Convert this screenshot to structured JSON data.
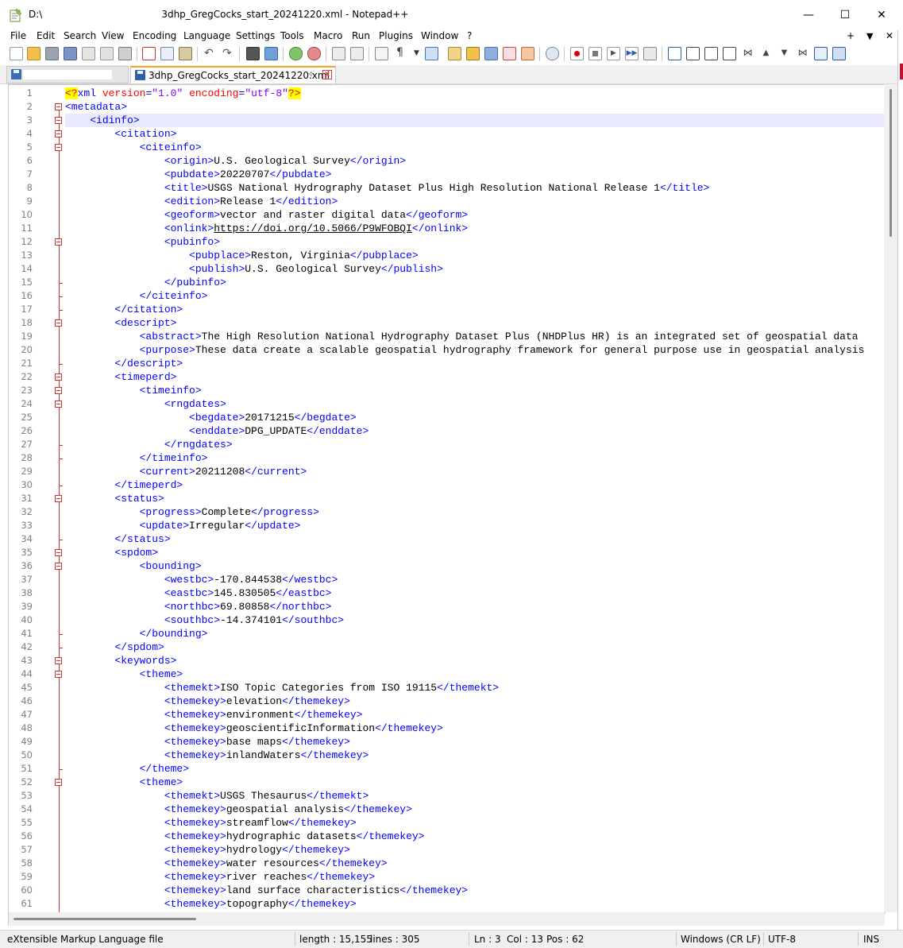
{
  "window": {
    "title_prefix": "D:\\",
    "title_suffix": "3dhp_GregCocks_start_20241220.xml - Notepad++",
    "minimize": "—",
    "maximize": "☐",
    "close": "✕"
  },
  "menu": [
    "File",
    "Edit",
    "Search",
    "View",
    "Encoding",
    "Language",
    "Settings",
    "Tools",
    "Macro",
    "Run",
    "Plugins",
    "Window",
    "?"
  ],
  "menu_right": {
    "plus": "+",
    "dropdown": "▼",
    "close": "✕"
  },
  "tabs": {
    "active_label": "3dhp_GregCocks_start_20241220.xml",
    "pin": "📌",
    "close": "x"
  },
  "code_lines": [
    {
      "n": "1",
      "h": "<span class='pi'>&lt;?</span><span class='t'>xml</span> <span class='a'>version</span><span class='t'>=</span><span class='v'>\"1.0\"</span> <span class='a'>encoding</span><span class='t'>=</span><span class='v'>\"utf-8\"</span><span class='pi'>?&gt;</span>"
    },
    {
      "n": "2",
      "h": "<span class='t'>&lt;metadata&gt;</span>",
      "fold": true
    },
    {
      "n": "3",
      "h": "    <span class='t'>&lt;idinfo&gt;</span>",
      "fold": true,
      "current": true
    },
    {
      "n": "4",
      "h": "        <span class='t'>&lt;citation&gt;</span>",
      "fold": true
    },
    {
      "n": "5",
      "h": "            <span class='t'>&lt;citeinfo&gt;</span>",
      "fold": true
    },
    {
      "n": "6",
      "h": "                <span class='t'>&lt;origin&gt;</span>U.S. Geological Survey<span class='t'>&lt;/origin&gt;</span>"
    },
    {
      "n": "7",
      "h": "                <span class='t'>&lt;pubdate&gt;</span>20220707<span class='t'>&lt;/pubdate&gt;</span>"
    },
    {
      "n": "8",
      "h": "                <span class='t'>&lt;title&gt;</span>USGS National Hydrography Dataset Plus High Resolution National Release 1<span class='t'>&lt;/title&gt;</span>"
    },
    {
      "n": "9",
      "h": "                <span class='t'>&lt;edition&gt;</span>Release 1<span class='t'>&lt;/edition&gt;</span>"
    },
    {
      "n": "10",
      "h": "                <span class='t'>&lt;geoform&gt;</span>vector and raster digital data<span class='t'>&lt;/geoform&gt;</span>"
    },
    {
      "n": "11",
      "h": "                <span class='t'>&lt;onlink&gt;</span><span class='link'>https://doi.org/10.5066/P9WFOBQI</span><span class='t'>&lt;/onlink&gt;</span>"
    },
    {
      "n": "12",
      "h": "                <span class='t'>&lt;pubinfo&gt;</span>",
      "fold": true
    },
    {
      "n": "13",
      "h": "                    <span class='t'>&lt;pubplace&gt;</span>Reston, Virginia<span class='t'>&lt;/pubplace&gt;</span>"
    },
    {
      "n": "14",
      "h": "                    <span class='t'>&lt;publish&gt;</span>U.S. Geological Survey<span class='t'>&lt;/publish&gt;</span>"
    },
    {
      "n": "15",
      "h": "                <span class='t'>&lt;/pubinfo&gt;</span>",
      "tick": true
    },
    {
      "n": "16",
      "h": "            <span class='t'>&lt;/citeinfo&gt;</span>",
      "tick": true
    },
    {
      "n": "17",
      "h": "        <span class='t'>&lt;/citation&gt;</span>",
      "tick": true
    },
    {
      "n": "18",
      "h": "        <span class='t'>&lt;descript&gt;</span>",
      "fold": true
    },
    {
      "n": "19",
      "h": "            <span class='t'>&lt;abstract&gt;</span>The High Resolution National Hydrography Dataset Plus (NHDPlus HR) is an integrated set of geospatial data"
    },
    {
      "n": "20",
      "h": "            <span class='t'>&lt;purpose&gt;</span>These data create a scalable geospatial hydrography framework for general purpose use in geospatial analysis"
    },
    {
      "n": "21",
      "h": "        <span class='t'>&lt;/descript&gt;</span>",
      "tick": true
    },
    {
      "n": "22",
      "h": "        <span class='t'>&lt;timeperd&gt;</span>",
      "fold": true
    },
    {
      "n": "23",
      "h": "            <span class='t'>&lt;timeinfo&gt;</span>",
      "fold": true
    },
    {
      "n": "24",
      "h": "                <span class='t'>&lt;rngdates&gt;</span>",
      "fold": true
    },
    {
      "n": "25",
      "h": "                    <span class='t'>&lt;begdate&gt;</span>20171215<span class='t'>&lt;/begdate&gt;</span>"
    },
    {
      "n": "26",
      "h": "                    <span class='t'>&lt;enddate&gt;</span>DPG_UPDATE<span class='t'>&lt;/enddate&gt;</span>"
    },
    {
      "n": "27",
      "h": "                <span class='t'>&lt;/rngdates&gt;</span>",
      "tick": true
    },
    {
      "n": "28",
      "h": "            <span class='t'>&lt;/timeinfo&gt;</span>",
      "tick": true
    },
    {
      "n": "29",
      "h": "            <span class='t'>&lt;current&gt;</span>20211208<span class='t'>&lt;/current&gt;</span>"
    },
    {
      "n": "30",
      "h": "        <span class='t'>&lt;/timeperd&gt;</span>",
      "tick": true
    },
    {
      "n": "31",
      "h": "        <span class='t'>&lt;status&gt;</span>",
      "fold": true
    },
    {
      "n": "32",
      "h": "            <span class='t'>&lt;progress&gt;</span>Complete<span class='t'>&lt;/progress&gt;</span>"
    },
    {
      "n": "33",
      "h": "            <span class='t'>&lt;update&gt;</span>Irregular<span class='t'>&lt;/update&gt;</span>"
    },
    {
      "n": "34",
      "h": "        <span class='t'>&lt;/status&gt;</span>",
      "tick": true
    },
    {
      "n": "35",
      "h": "        <span class='t'>&lt;spdom&gt;</span>",
      "fold": true
    },
    {
      "n": "36",
      "h": "            <span class='t'>&lt;bounding&gt;</span>",
      "fold": true
    },
    {
      "n": "37",
      "h": "                <span class='t'>&lt;westbc&gt;</span>-170.844538<span class='t'>&lt;/westbc&gt;</span>"
    },
    {
      "n": "38",
      "h": "                <span class='t'>&lt;eastbc&gt;</span>145.830505<span class='t'>&lt;/eastbc&gt;</span>"
    },
    {
      "n": "39",
      "h": "                <span class='t'>&lt;northbc&gt;</span>69.80858<span class='t'>&lt;/northbc&gt;</span>"
    },
    {
      "n": "40",
      "h": "                <span class='t'>&lt;southbc&gt;</span>-14.374101<span class='t'>&lt;/southbc&gt;</span>"
    },
    {
      "n": "41",
      "h": "            <span class='t'>&lt;/bounding&gt;</span>",
      "tick": true
    },
    {
      "n": "42",
      "h": "        <span class='t'>&lt;/spdom&gt;</span>",
      "tick": true
    },
    {
      "n": "43",
      "h": "        <span class='t'>&lt;keywords&gt;</span>",
      "fold": true
    },
    {
      "n": "44",
      "h": "            <span class='t'>&lt;theme&gt;</span>",
      "fold": true
    },
    {
      "n": "45",
      "h": "                <span class='t'>&lt;themekt&gt;</span>ISO Topic Categories from ISO 19115<span class='t'>&lt;/themekt&gt;</span>"
    },
    {
      "n": "46",
      "h": "                <span class='t'>&lt;themekey&gt;</span>elevation<span class='t'>&lt;/themekey&gt;</span>"
    },
    {
      "n": "47",
      "h": "                <span class='t'>&lt;themekey&gt;</span>environment<span class='t'>&lt;/themekey&gt;</span>"
    },
    {
      "n": "48",
      "h": "                <span class='t'>&lt;themekey&gt;</span>geoscientificInformation<span class='t'>&lt;/themekey&gt;</span>"
    },
    {
      "n": "49",
      "h": "                <span class='t'>&lt;themekey&gt;</span>base maps<span class='t'>&lt;/themekey&gt;</span>"
    },
    {
      "n": "50",
      "h": "                <span class='t'>&lt;themekey&gt;</span>inlandWaters<span class='t'>&lt;/themekey&gt;</span>"
    },
    {
      "n": "51",
      "h": "            <span class='t'>&lt;/theme&gt;</span>",
      "tick": true
    },
    {
      "n": "52",
      "h": "            <span class='t'>&lt;theme&gt;</span>",
      "fold": true
    },
    {
      "n": "53",
      "h": "                <span class='t'>&lt;themekt&gt;</span>USGS Thesaurus<span class='t'>&lt;/themekt&gt;</span>"
    },
    {
      "n": "54",
      "h": "                <span class='t'>&lt;themekey&gt;</span>geospatial analysis<span class='t'>&lt;/themekey&gt;</span>"
    },
    {
      "n": "55",
      "h": "                <span class='t'>&lt;themekey&gt;</span>streamflow<span class='t'>&lt;/themekey&gt;</span>"
    },
    {
      "n": "56",
      "h": "                <span class='t'>&lt;themekey&gt;</span>hydrographic datasets<span class='t'>&lt;/themekey&gt;</span>"
    },
    {
      "n": "57",
      "h": "                <span class='t'>&lt;themekey&gt;</span>hydrology<span class='t'>&lt;/themekey&gt;</span>"
    },
    {
      "n": "58",
      "h": "                <span class='t'>&lt;themekey&gt;</span>water resources<span class='t'>&lt;/themekey&gt;</span>"
    },
    {
      "n": "59",
      "h": "                <span class='t'>&lt;themekey&gt;</span>river reaches<span class='t'>&lt;/themekey&gt;</span>"
    },
    {
      "n": "60",
      "h": "                <span class='t'>&lt;themekey&gt;</span>land surface characteristics<span class='t'>&lt;/themekey&gt;</span>"
    },
    {
      "n": "61",
      "h": "                <span class='t'>&lt;themekey&gt;</span>topography<span class='t'>&lt;/themekey&gt;</span>"
    }
  ],
  "status": {
    "file_type": "eXtensible Markup Language file",
    "length": "length : 15,155",
    "lines": "lines : 305",
    "ln": "Ln : 3",
    "col": "Col : 13",
    "pos": "Pos : 62",
    "eol": "Windows (CR LF)",
    "encoding": "UTF-8",
    "mode": "INS"
  }
}
